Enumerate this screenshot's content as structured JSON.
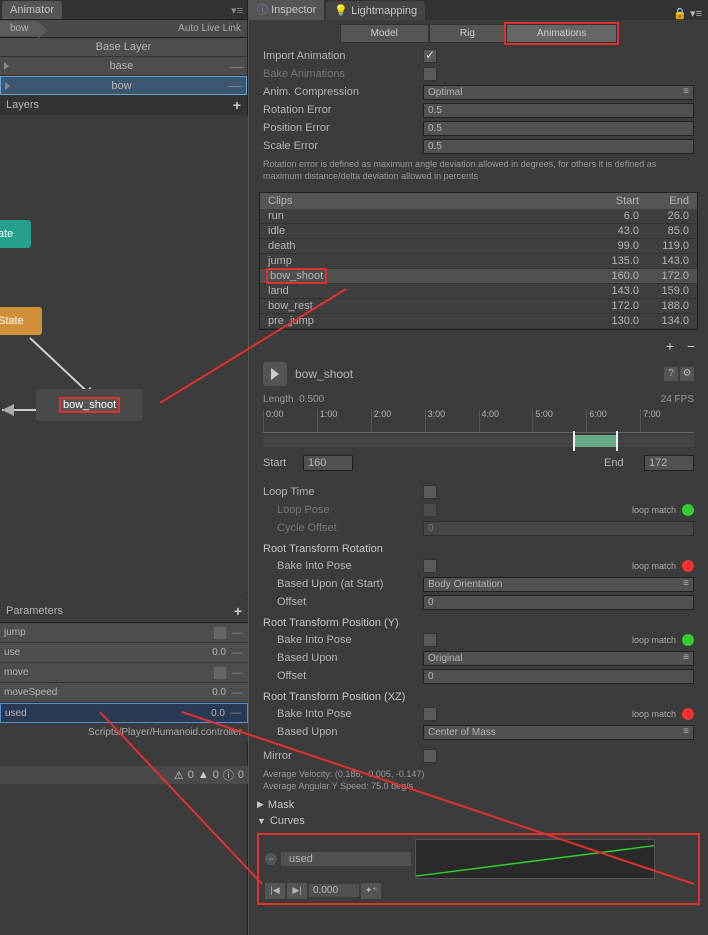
{
  "animator": {
    "tab": "Animator",
    "breadcrumb": "bow",
    "live_link": "Auto Live Link",
    "layers_title": "Layers",
    "layers": [
      {
        "name": "Base Layer"
      },
      {
        "name": "base"
      },
      {
        "name": "bow"
      }
    ],
    "nodes": {
      "teal": "ate",
      "orange": "State",
      "gray": "bow_shoot"
    }
  },
  "parameters": {
    "title": "Parameters",
    "items": [
      {
        "name": "jump",
        "val": "",
        "type": "check"
      },
      {
        "name": "use",
        "val": "0.0",
        "type": "float"
      },
      {
        "name": "move",
        "val": "",
        "type": "check"
      },
      {
        "name": "moveSpeed",
        "val": "0.0",
        "type": "float"
      },
      {
        "name": "used",
        "val": "0.0",
        "type": "float"
      }
    ],
    "path": "Scripts/Player/Humanoid.controller"
  },
  "audio": {
    "count1": "0",
    "count2": "0",
    "count3": "0"
  },
  "inspector": {
    "tab1": "Inspector",
    "tab2": "Lightmapping",
    "subtabs": {
      "model": "Model",
      "rig": "Rig",
      "anim": "Animations"
    },
    "import_anim": "Import Animation",
    "bake_anim": "Bake Animations",
    "anim_comp": "Anim. Compression",
    "anim_comp_val": "Optimal",
    "rot_err": "Rotation Error",
    "rot_err_val": "0.5",
    "pos_err": "Position Error",
    "pos_err_val": "0.5",
    "scale_err": "Scale Error",
    "scale_err_val": "0.5",
    "help": "Rotation error is defined as maximum angle deviation allowed in degrees, for others it is defined as maximum distance/delta deviation allowed in percents",
    "clips_hdr": {
      "c1": "Clips",
      "c2": "Start",
      "c3": "End"
    },
    "clips": [
      {
        "name": "run",
        "start": "6.0",
        "end": "26.0"
      },
      {
        "name": "idle",
        "start": "43.0",
        "end": "85.0"
      },
      {
        "name": "death",
        "start": "99.0",
        "end": "119.0"
      },
      {
        "name": "jump",
        "start": "135.0",
        "end": "143.0"
      },
      {
        "name": "bow_shoot",
        "start": "160.0",
        "end": "172.0"
      },
      {
        "name": "land",
        "start": "143.0",
        "end": "159.0"
      },
      {
        "name": "bow_rest",
        "start": "172.0",
        "end": "188.0"
      },
      {
        "name": "pre_jump",
        "start": "130.0",
        "end": "134.0"
      }
    ],
    "clip_name": "bow_shoot",
    "length_lbl": "Length",
    "length_val": "0.500",
    "fps": "24 FPS",
    "ticks": [
      "0:00",
      "1:00",
      "2:00",
      "3:00",
      "4:00",
      "5:00",
      "6:00",
      "7:00"
    ],
    "start_lbl": "Start",
    "start_val": "160",
    "end_lbl": "End",
    "end_val": "172",
    "loop_time": "Loop Time",
    "loop_pose": "Loop Pose",
    "cycle_offset": "Cycle Offset",
    "cycle_offset_val": "0",
    "loop_match": "loop match",
    "rtr": "Root Transform Rotation",
    "rtr_bake": "Bake Into Pose",
    "rtr_based": "Based Upon (at Start)",
    "rtr_based_val": "Body Orientation",
    "rtr_offset": "Offset",
    "rtr_offset_val": "0",
    "rtpy": "Root Transform Position (Y)",
    "rtpy_bake": "Bake Into Pose",
    "rtpy_based": "Based Upon",
    "rtpy_based_val": "Original",
    "rtpy_offset": "Offset",
    "rtpy_offset_val": "0",
    "rtpxz": "Root Transform Position (XZ)",
    "rtpxz_bake": "Bake Into Pose",
    "rtpxz_based": "Based Upon",
    "rtpxz_based_val": "Center of Mass",
    "mirror": "Mirror",
    "avg_vel": "Average Velocity: (0.186, -0.005, -0.147)",
    "avg_ang": "Average Angular Y Speed: 75.0 deg/s",
    "mask": "Mask",
    "curves": "Curves",
    "curve_name": "used",
    "pb_time": "0.000"
  }
}
